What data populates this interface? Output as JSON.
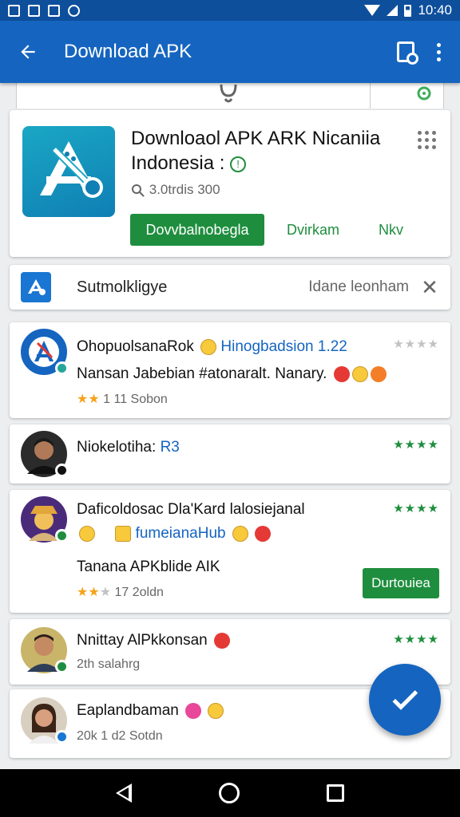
{
  "status_bar": {
    "time": "10:40",
    "icons": [
      "image-icon",
      "cast-icon",
      "photo-icon",
      "alert-icon",
      "wifi-icon",
      "signal-icon",
      "battery-icon"
    ]
  },
  "app_bar": {
    "title": "Download APK",
    "icons": [
      "back-arrow-icon",
      "device-link-icon",
      "more-vert-icon"
    ]
  },
  "app": {
    "name": "Downloaol APK ARK Nicaniia Indonesia",
    "info_symbol": ": ",
    "meta": "3.0trdis 300",
    "primary_button": "Dovvbalnobegla",
    "button2": "Dvirkam",
    "button3": "Nkv"
  },
  "suggestion": {
    "label": "Sutmolkligye",
    "right_text": "Idane leonham",
    "close_symbol": "✕"
  },
  "reviews": [
    {
      "title": "Ohopuolsana",
      "title_tail": "Rok",
      "title_blue": "Hinogbadsion 1.22",
      "line2": "Nansan Jabebian #atonaralt. Nanary.",
      "meta": "1 11 Sobon",
      "stars": "★★★★",
      "star_color": "grey",
      "filled": 2
    },
    {
      "title": "Niokelotiha:",
      "title_blue": "R3",
      "stars": "★★★★",
      "star_color": "green"
    },
    {
      "title": "Daficoldosac Dla'Kard lalosiejanal",
      "line2_blue": "fumeianaHub",
      "line3": "Tanana APKblide AIK",
      "meta": "17 2oldn",
      "button": "Durtouiea",
      "stars": "★★★★",
      "star_color": "green",
      "filled": 2
    },
    {
      "title": "Nnittay AlPkkonsan",
      "meta": "2th salahrg",
      "stars": "★★★★",
      "star_color": "green"
    },
    {
      "title": "Eaplandbaman",
      "meta": "20k 1 d2 Sotdn"
    }
  ],
  "colors": {
    "app_bar": "#1565c0",
    "status_bar": "#0e4f9c",
    "accent_green": "#1e8e3e",
    "star_gold": "#f4a31b"
  }
}
